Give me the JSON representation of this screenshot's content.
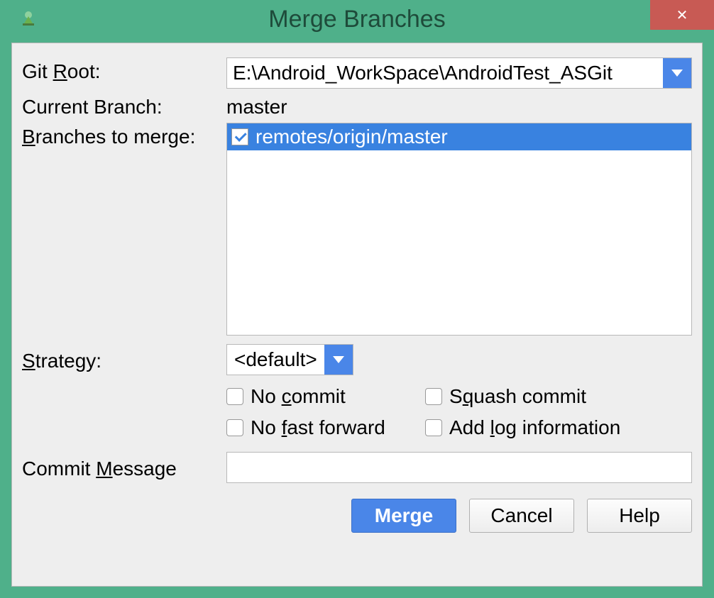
{
  "window": {
    "title": "Merge Branches"
  },
  "form": {
    "gitRootLabelPrefix": "Git ",
    "gitRootLabelUnder": "R",
    "gitRootLabelSuffix": "oot:",
    "gitRootValue": "E:\\Android_WorkSpace\\AndroidTest_ASGit",
    "currentBranchLabel": "Current Branch:",
    "currentBranchValue": "master",
    "branchesLabelUnder": "B",
    "branchesLabelSuffix": "ranches to merge:",
    "branches": [
      {
        "label": "remotes/origin/master",
        "checked": true
      }
    ],
    "strategyLabelUnder": "S",
    "strategyLabelSuffix": "trategy:",
    "strategyValue": "<default>",
    "options": {
      "noCommitPrefix": "No ",
      "noCommitUnder": "c",
      "noCommitSuffix": "ommit",
      "squashPrefix": "S",
      "squashUnder": "q",
      "squashSuffix": "uash commit",
      "noFFPrefix": "No ",
      "noFFUnder": "f",
      "noFFSuffix": "ast forward",
      "addLogPrefix": "Add ",
      "addLogUnder": "l",
      "addLogSuffix": "og information"
    },
    "commitMsgLabelPrefix": "Commit ",
    "commitMsgLabelUnder": "M",
    "commitMsgLabelSuffix": "essage",
    "commitMsgValue": ""
  },
  "buttons": {
    "merge": "Merge",
    "cancel": "Cancel",
    "help": "Help"
  }
}
